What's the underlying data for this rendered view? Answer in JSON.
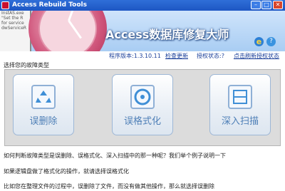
{
  "window": {
    "title": "Access Rebuild Tools",
    "minimize_glyph": "–",
    "maximize_glyph": "□",
    "close_glyph": "✕"
  },
  "banner": {
    "brand": "Access数据库修复大师",
    "book_lines": [
      "InstAS.exe",
      "\"Set the R",
      "for service",
      "dwServiceR"
    ],
    "icons": [
      "ie-icon",
      "help-icon"
    ]
  },
  "info": {
    "version": "程序版本:1.3.10.11",
    "check_update": "检查更新",
    "auth_status": "授权状态:?",
    "refresh": "点击刷新授权状态"
  },
  "section": {
    "label": "选择您的故障类型"
  },
  "tiles": [
    {
      "label": "误删除",
      "icon": "recycle-icon"
    },
    {
      "label": "误格式化",
      "icon": "format-disk-icon"
    },
    {
      "label": "深入扫描",
      "icon": "deep-scan-icon"
    }
  ],
  "description": [
    "如何判断故障类型是误删除、误格式化、深入扫描中的那一种呢？我们举个例子说明一下",
    "如果逻辑盘做了格式化的操作，就请选择误格式化",
    "比如您在整理文件的过程中，误删除了文件，而没有做其他操作，那么就选择误删除"
  ]
}
